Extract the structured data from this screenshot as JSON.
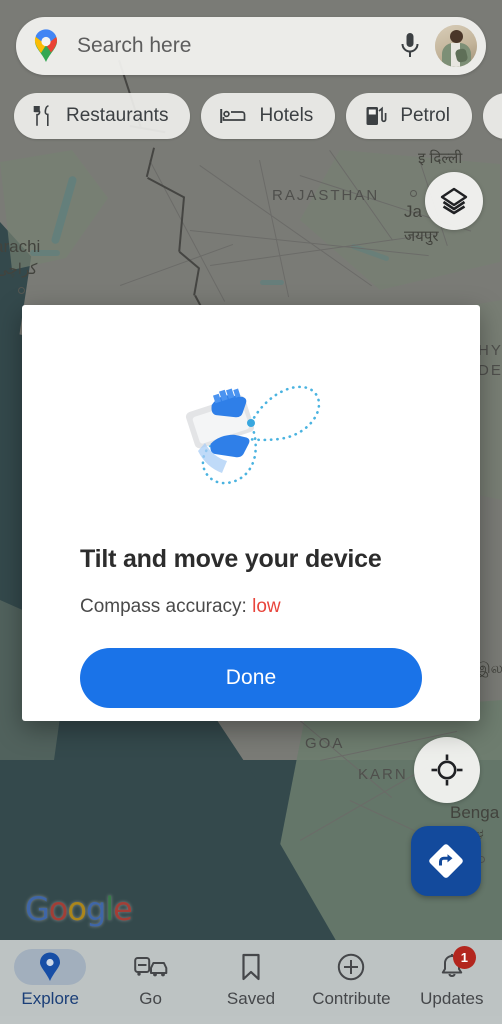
{
  "search": {
    "placeholder": "Search here",
    "logo_icon": "google-maps-pin-icon",
    "mic_icon": "microphone-icon",
    "avatar_icon": "profile-avatar"
  },
  "chips": [
    {
      "label": "Restaurants",
      "icon": "restaurant-icon"
    },
    {
      "label": "Hotels",
      "icon": "hotel-bed-icon"
    },
    {
      "label": "Petrol",
      "icon": "petrol-pump-icon"
    },
    {
      "label": "",
      "icon": "atm-icon"
    }
  ],
  "map": {
    "labels": [
      {
        "text": "RAJASTHAN",
        "type": "region"
      },
      {
        "text": "Ja",
        "type": "city"
      },
      {
        "text": "जयपुर",
        "type": "city-sub"
      },
      {
        "text": "arachi",
        "type": "city"
      },
      {
        "text": "کراچی",
        "type": "city-sub"
      },
      {
        "text": "इ दिल्ली",
        "type": "city-sub"
      },
      {
        "text": "HY",
        "type": "region"
      },
      {
        "text": "DES",
        "type": "region"
      },
      {
        "text": "இலங",
        "type": "city-sub"
      },
      {
        "text": "GOA",
        "type": "region"
      },
      {
        "text": "KARN",
        "type": "region"
      },
      {
        "text": "Benga",
        "type": "city"
      },
      {
        "text": "ಬೆಂಗಳ",
        "type": "city-sub"
      }
    ],
    "attribution": "Google",
    "attribution_letters": [
      "G",
      "o",
      "o",
      "g",
      "l",
      "e"
    ],
    "layers_button_icon": "layers-icon",
    "locate_button_icon": "my-location-crosshair-icon",
    "directions_fab_icon": "directions-arrow-icon",
    "colors": {
      "water": "#2f5459",
      "land": "#a8a9a1",
      "vegetation": "#9fb49a",
      "fab_blue": "#134a9c"
    }
  },
  "dialog": {
    "title": "Tilt and move your device",
    "subtitle_prefix": "Compass accuracy: ",
    "accuracy_value": "low",
    "accuracy_color": "#e8453c",
    "done_label": "Done",
    "done_color": "#1a73e8",
    "illustration_icon": "hand-holding-phone-figure-eight-icon"
  },
  "bottom_nav": [
    {
      "label": "Explore",
      "icon": "location-pin-icon",
      "active": true,
      "badge": ""
    },
    {
      "label": "Go",
      "icon": "commute-icon",
      "active": false,
      "badge": ""
    },
    {
      "label": "Saved",
      "icon": "bookmark-icon",
      "active": false,
      "badge": ""
    },
    {
      "label": "Contribute",
      "icon": "plus-circle-icon",
      "active": false,
      "badge": ""
    },
    {
      "label": "Updates",
      "icon": "bell-icon",
      "active": false,
      "badge": "1"
    }
  ]
}
